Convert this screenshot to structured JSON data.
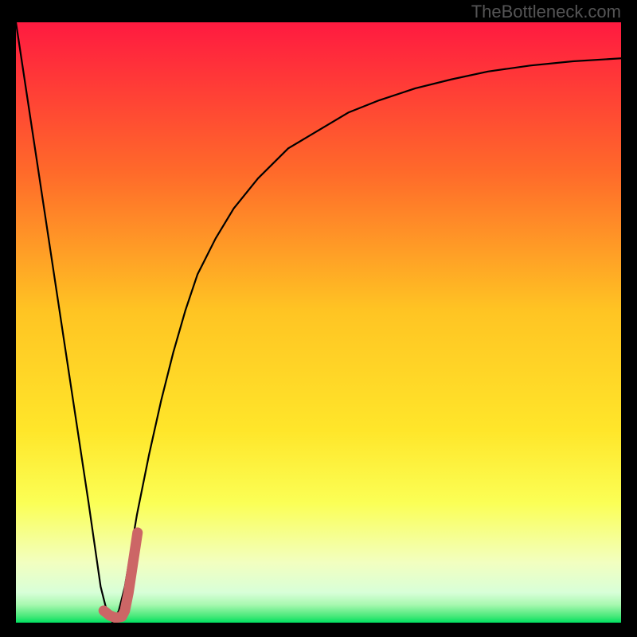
{
  "watermark": "TheBottleneck.com",
  "colors": {
    "gradient_top": "#ff1a40",
    "gradient_mid_upper": "#ffa030",
    "gradient_mid": "#ffe030",
    "gradient_lower": "#faff70",
    "gradient_pale": "#f8ffe0",
    "gradient_bottom": "#00e060",
    "curve": "#000000",
    "marker": "#cc6666",
    "frame": "#000000"
  },
  "chart_data": {
    "type": "line",
    "title": "",
    "xlabel": "",
    "ylabel": "",
    "xlim": [
      0,
      100
    ],
    "ylim": [
      0,
      100
    ],
    "series": [
      {
        "name": "bottleneck-curve",
        "x": [
          0,
          3,
          6,
          9,
          12,
          14,
          15,
          16,
          17,
          18,
          19,
          20,
          22,
          24,
          26,
          28,
          30,
          33,
          36,
          40,
          45,
          50,
          55,
          60,
          66,
          72,
          78,
          85,
          92,
          100
        ],
        "values": [
          100,
          80,
          60,
          40,
          20,
          6,
          2,
          0,
          2,
          6,
          12,
          18,
          28,
          37,
          45,
          52,
          58,
          64,
          69,
          74,
          79,
          82,
          85,
          87,
          89,
          90.5,
          91.8,
          92.8,
          93.5,
          94
        ]
      }
    ],
    "marker": {
      "name": "j-marker",
      "x": [
        14.5,
        15.5,
        16.5,
        17.5,
        18.0,
        18.3,
        18.6,
        18.9,
        19.2,
        19.5,
        19.8,
        20.1
      ],
      "values": [
        2.0,
        1.2,
        0.8,
        1.0,
        2.0,
        3.5,
        5.0,
        7.0,
        9.0,
        11.0,
        13.0,
        15.0
      ]
    }
  }
}
